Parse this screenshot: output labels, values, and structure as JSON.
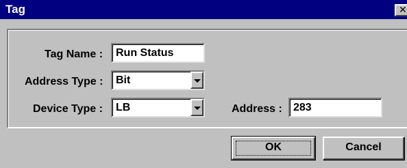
{
  "window": {
    "title": "Tag",
    "close_label": "✕"
  },
  "form": {
    "tag_name": {
      "label": "Tag Name :",
      "value": "Run Status"
    },
    "address_type": {
      "label": "Address Type :",
      "value": "Bit"
    },
    "device_type": {
      "label": "Device Type :",
      "value": "LB"
    },
    "address": {
      "label": "Address :",
      "value": "283"
    }
  },
  "buttons": {
    "ok": "OK",
    "cancel": "Cancel"
  }
}
